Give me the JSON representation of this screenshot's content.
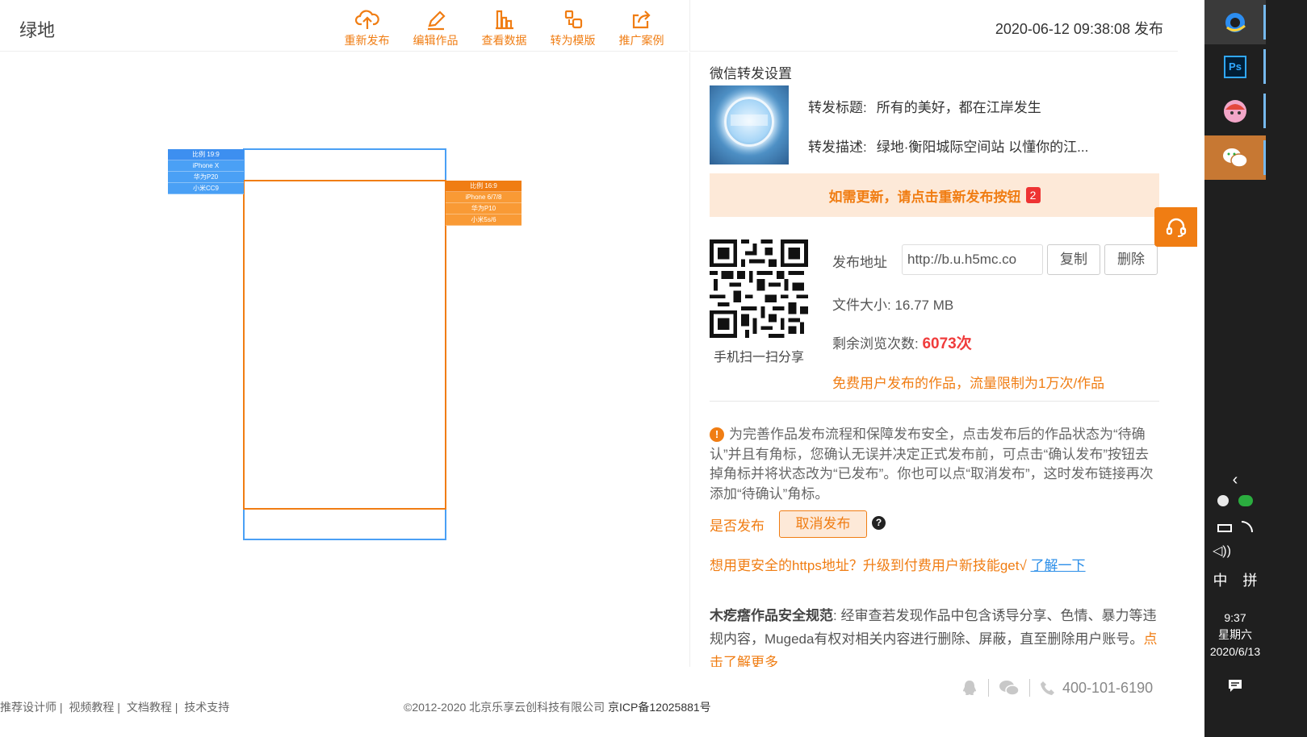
{
  "header": {
    "title": "绿地",
    "toolbar": [
      {
        "label": "重新发布",
        "icon": "cloud-upload-icon"
      },
      {
        "label": "编辑作品",
        "icon": "pencil-icon"
      },
      {
        "label": "查看数据",
        "icon": "bar-chart-icon"
      },
      {
        "label": "转为模版",
        "icon": "convert-template-icon"
      },
      {
        "label": "推广案例",
        "icon": "share-export-icon"
      }
    ]
  },
  "preview": {
    "tag_blue": [
      "比例 19:9",
      "iPhone X",
      "华为P20",
      "小米CC9"
    ],
    "tag_orange": [
      "比例 16:9",
      "iPhone 6/7/8",
      "华为P10",
      "小米5s/6"
    ]
  },
  "panel": {
    "publish_time": "2020-06-12 09:38:08 发布",
    "wechat_title": "微信转发设置",
    "share_title_label": "转发标题:",
    "share_title_value": "所有的美好，都在江岸发生",
    "share_desc_label": "转发描述:",
    "share_desc_value": "绿地·衡阳城际空间站 以懂你的江...",
    "notice_text": "如需更新，请点击重新发布按钮",
    "notice_badge": "2",
    "qr_caption": "手机扫一扫分享",
    "address_label": "发布地址",
    "address_value": "http://b.u.h5mc.co",
    "copy_button": "复制",
    "delete_button": "删除",
    "file_size_label": "文件大小:",
    "file_size_value": "16.77 MB",
    "views_label": "剩余浏览次数:",
    "views_value": "6073次",
    "limit_text": "免费用户发布的作品，流量限制为1万次/作品",
    "warning_text": "为完善作品发布流程和保障发布安全，点击发布后的作品状态为“待确认”并且有角标，您确认无误并决定正式发布前，可点击“确认发布”按钮去掉角标并将状态改为“已发布”。你也可以点“取消发布”，这时发布链接再次添加“待确认”角标。",
    "publish_label": "是否发布",
    "cancel_publish_button": "取消发布",
    "https_text": "想用更安全的https地址？升级到付费用户新技能get√",
    "https_link": "了解一下",
    "rules_title": "木疙瘩作品安全规范",
    "rules_text": ": 经审查若发现作品中包含诱导分享、色情、暴力等违规内容，Mugeda有权对相关内容进行删除、屏蔽，直至删除用户账号。",
    "rules_link": "点击了解更多"
  },
  "footer": {
    "links": [
      "推荐设计师 |",
      "视频教程 |",
      "文档教程 |",
      "技术支持"
    ],
    "copyright": "©2012-2020 北京乐享云创科技有限公司",
    "icp": "京ICP备12025881号",
    "phone": "400-101-6190"
  },
  "taskbar": {
    "apps": [
      "qq-browser-icon",
      "photoshop-icon",
      "app-avatar-icon",
      "wechat-icon"
    ],
    "ps_label": "Ps",
    "ime_lang": "中",
    "ime_mode": "拼",
    "time": "9:37",
    "weekday": "星期六",
    "date": "2020/6/13"
  },
  "colors": {
    "accent": "#f07d13",
    "blue": "#4aa0f5",
    "notice_bg": "#fde9d8",
    "taskbar": "#1f1f1f"
  }
}
